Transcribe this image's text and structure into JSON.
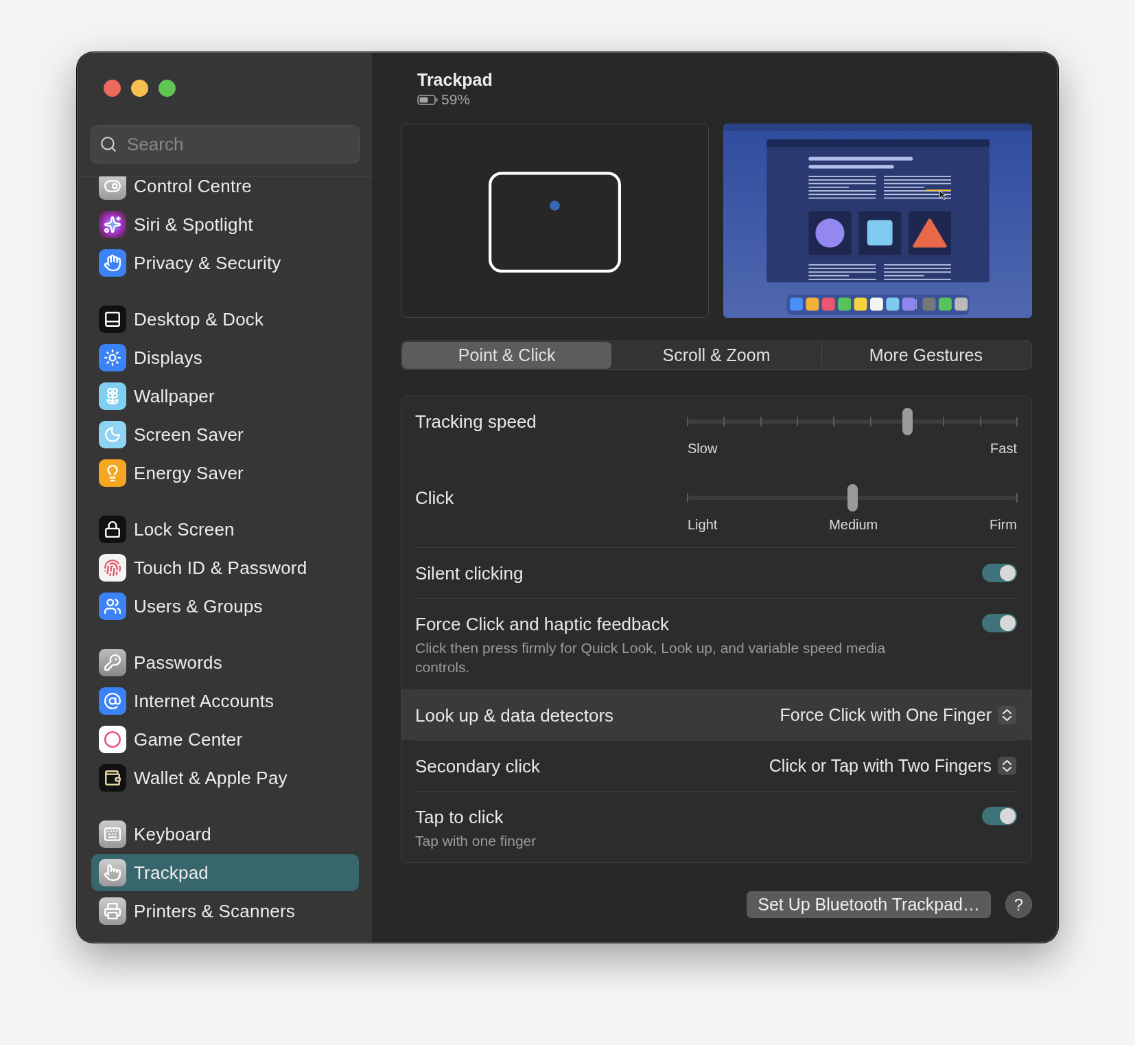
{
  "window": {
    "title": "Trackpad",
    "battery": "59%"
  },
  "sidebar": {
    "search": {
      "placeholder": "Search"
    },
    "sections": [
      {
        "items": [
          {
            "label": "Control Centre",
            "selected": false
          },
          {
            "label": "Siri & Spotlight",
            "selected": false
          },
          {
            "label": "Privacy & Security",
            "selected": false
          }
        ]
      },
      {
        "items": [
          {
            "label": "Desktop & Dock",
            "selected": false
          },
          {
            "label": "Displays",
            "selected": false
          },
          {
            "label": "Wallpaper",
            "selected": false
          },
          {
            "label": "Screen Saver",
            "selected": false
          },
          {
            "label": "Energy Saver",
            "selected": false
          }
        ]
      },
      {
        "items": [
          {
            "label": "Lock Screen",
            "selected": false
          },
          {
            "label": "Touch ID & Password",
            "selected": false
          },
          {
            "label": "Users & Groups",
            "selected": false
          }
        ]
      },
      {
        "items": [
          {
            "label": "Passwords",
            "selected": false
          },
          {
            "label": "Internet Accounts",
            "selected": false
          },
          {
            "label": "Game Center",
            "selected": false
          },
          {
            "label": "Wallet & Apple Pay",
            "selected": false
          }
        ]
      },
      {
        "items": [
          {
            "label": "Keyboard",
            "selected": false
          },
          {
            "label": "Trackpad",
            "selected": true
          },
          {
            "label": "Printers & Scanners",
            "selected": false
          }
        ]
      }
    ]
  },
  "tabs": [
    {
      "label": "Point & Click",
      "selected": true
    },
    {
      "label": "Scroll & Zoom",
      "selected": false
    },
    {
      "label": "More Gestures",
      "selected": false
    }
  ],
  "settings": [
    {
      "kind": "slider",
      "label": "Tracking speed",
      "notched": true,
      "level": 0.667,
      "scale": [
        "Slow",
        "Fast"
      ]
    },
    {
      "kind": "slider",
      "label": "Click",
      "notched": false,
      "level": 0.5,
      "scale": [
        "Light",
        "Medium",
        "Firm"
      ]
    },
    {
      "kind": "toggle",
      "label": "Silent clicking",
      "on": true
    },
    {
      "kind": "toggle",
      "label": "Force Click and haptic feedback",
      "description": "Click then press firmly for Quick Look, Look up, and variable speed media controls.",
      "on": true
    },
    {
      "kind": "popup",
      "label": "Look up & data detectors",
      "value": "Force Click with One Finger",
      "highlighted": true
    },
    {
      "kind": "popup",
      "label": "Secondary click",
      "value": "Click or Tap with Two Fingers",
      "highlighted": false
    },
    {
      "kind": "toggle",
      "label": "Tap to click",
      "description": "Tap with one finger",
      "on": true
    }
  ],
  "footer": {
    "button": "Set Up Bluetooth Trackpad…",
    "help": "?"
  }
}
